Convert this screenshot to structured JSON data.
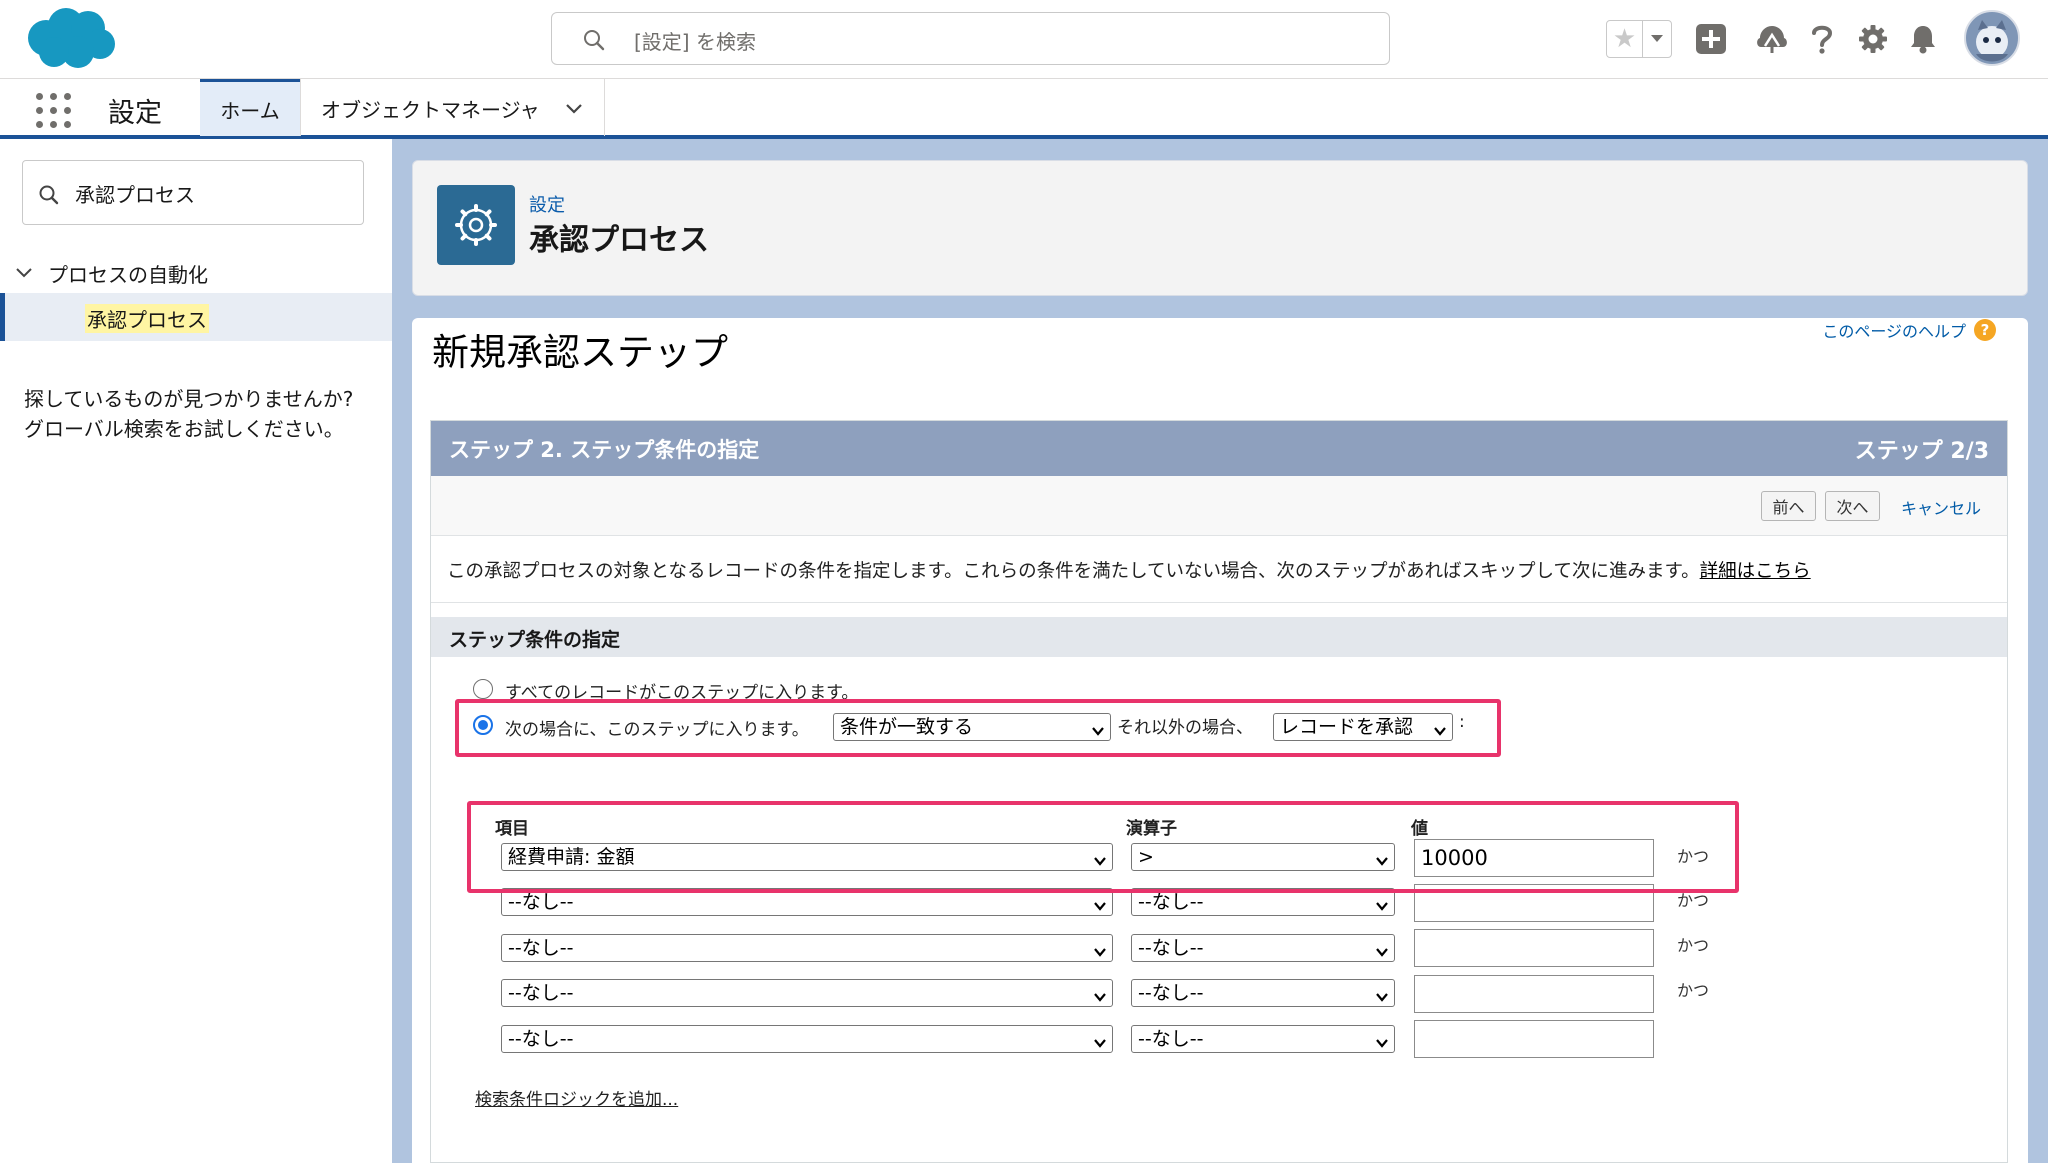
{
  "header": {
    "search_placeholder": "[設定] を検索",
    "icons": [
      "salesforce-cloud-logo",
      "search-icon",
      "star-icon",
      "dropdown-icon",
      "add-icon",
      "trailhead-icon",
      "help-icon",
      "gear-icon",
      "bell-icon",
      "avatar"
    ]
  },
  "context_bar": {
    "app_name": "設定",
    "tabs": [
      {
        "label": "ホーム",
        "active": true
      },
      {
        "label": "オブジェクトマネージャ",
        "active": false
      }
    ]
  },
  "sidebar": {
    "quick_find_value": "承認プロセス",
    "tree": {
      "parent": "プロセスの自動化",
      "child": "承認プロセス"
    },
    "not_found_line1": "探しているものが見つかりませんか?",
    "not_found_line2": "グローバル検索をお試しください。"
  },
  "page_header": {
    "breadcrumb": "設定",
    "title": "承認プロセス"
  },
  "content": {
    "title": "新規承認ステップ",
    "help_link": "このページのヘルプ",
    "step_title": "ステップ 2. ステップ条件の指定",
    "step_count": "ステップ 2/3",
    "buttons": {
      "prev": "前へ",
      "next": "次へ",
      "cancel": "キャンセル"
    },
    "description": "この承認プロセスの対象となるレコードの条件を指定します。これらの条件を満たしていない場合、次のステップがあればスキップして次に進みます。",
    "description_link": "詳細はこちら",
    "section_title": "ステップ条件の指定",
    "radio_all": "すべてのレコードがこのステップに入ります。",
    "radio_cond": "次の場合に、このステップに入ります。",
    "criteria_select": "条件が一致する",
    "else_label": "それ以外の場合、",
    "else_select": "レコードを承認",
    "colon": ":",
    "columns": {
      "field": "項目",
      "operator": "演算子",
      "value": "値"
    },
    "rows": [
      {
        "field": "経費申請: 金額",
        "operator": ">",
        "value": "10000",
        "conj": "かつ"
      },
      {
        "field": "--なし--",
        "operator": "--なし--",
        "value": "",
        "conj": "かつ"
      },
      {
        "field": "--なし--",
        "operator": "--なし--",
        "value": "",
        "conj": "かつ"
      },
      {
        "field": "--なし--",
        "operator": "--なし--",
        "value": "",
        "conj": "かつ"
      },
      {
        "field": "--なし--",
        "operator": "--なし--",
        "value": "",
        "conj": ""
      }
    ],
    "logic_link": "検索条件ロジックを追加..."
  },
  "colors": {
    "brand_blue": "#1b5297",
    "main_bg": "#b0c4df",
    "step_header": "#8ea0be",
    "highlight": "#e8336b",
    "salesforce_logo": "#1798c1"
  }
}
